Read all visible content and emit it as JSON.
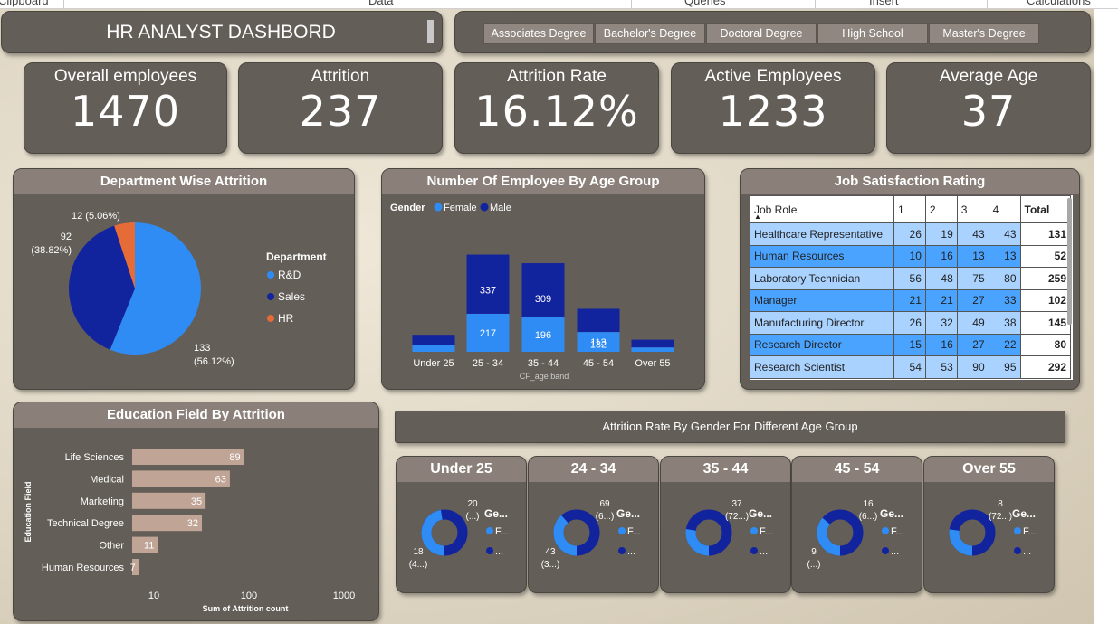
{
  "ribbon": [
    "Clipboard",
    "Data",
    "Queries",
    "Insert",
    "Calculations"
  ],
  "header": {
    "title": "HR  ANALYST DASHBORD"
  },
  "slicer": [
    "Associates Degree",
    "Bachelor's Degree",
    "Doctoral Degree",
    "High School",
    "Master's Degree"
  ],
  "kpis": [
    {
      "label": "Overall employees",
      "value": "1470"
    },
    {
      "label": "Attrition",
      "value": "237"
    },
    {
      "label": "Attrition Rate",
      "value": "16.12%"
    },
    {
      "label": "Active Employees",
      "value": "1233"
    },
    {
      "label": "Average Age",
      "value": "37"
    }
  ],
  "chart_data": [
    {
      "type": "pie",
      "title": "Department Wise Attrition",
      "legend_title": "Department",
      "legend_position": "right",
      "slices": [
        {
          "name": "R&D",
          "value": 133,
          "label": "133",
          "pct_label": "(56.12%)",
          "color": "#2f8cf5"
        },
        {
          "name": "Sales",
          "value": 92,
          "label": "92",
          "pct_label": "(38.82%)",
          "color": "#12239e"
        },
        {
          "name": "HR",
          "value": 12,
          "label": "12 (5.06%)",
          "pct_label": "",
          "color": "#e66c37"
        }
      ]
    },
    {
      "type": "bar",
      "stacked": true,
      "title": "Number Of Employee By Age Group",
      "legend_title": "Gender",
      "legend_position": "top-left",
      "xlabel": "CF_age band",
      "categories": [
        "Under 25",
        "25 - 34",
        "35 - 44",
        "45 - 54",
        "Over 55"
      ],
      "series": [
        {
          "name": "Female",
          "color": "#2f8cf5",
          "values": [
            38,
            217,
            196,
            113,
            25
          ],
          "labels": [
            "",
            "217",
            "196",
            "113",
            ""
          ]
        },
        {
          "name": "Male",
          "color": "#12239e",
          "values": [
            59,
            337,
            309,
            132,
            44
          ],
          "labels": [
            "",
            "337",
            "309",
            "132",
            ""
          ]
        }
      ]
    },
    {
      "type": "table",
      "title": "Job Satisfaction Rating",
      "columns": [
        "Job Role",
        "1",
        "2",
        "3",
        "4",
        "Total"
      ],
      "rows": [
        [
          "Healthcare Representative",
          "26",
          "19",
          "43",
          "43",
          "131"
        ],
        [
          "Human Resources",
          "10",
          "16",
          "13",
          "13",
          "52"
        ],
        [
          "Laboratory Technician",
          "56",
          "48",
          "75",
          "80",
          "259"
        ],
        [
          "Manager",
          "21",
          "21",
          "27",
          "33",
          "102"
        ],
        [
          "Manufacturing Director",
          "26",
          "32",
          "49",
          "38",
          "145"
        ],
        [
          "Research Director",
          "15",
          "16",
          "27",
          "22",
          "80"
        ],
        [
          "Research Scientist",
          "54",
          "53",
          "90",
          "95",
          "292"
        ]
      ]
    },
    {
      "type": "bar",
      "orientation": "horizontal",
      "title": "Education Field By Attrition",
      "ylabel": "Education Field",
      "xlabel": "Sum of Attrition count",
      "x_scale": "log",
      "x_ticks": [
        "10",
        "100",
        "1000"
      ],
      "categories": [
        "Life Sciences",
        "Medical",
        "Marketing",
        "Technical Degree",
        "Other",
        "Human Resources"
      ],
      "values": [
        89,
        63,
        35,
        32,
        11,
        7
      ],
      "color": "#c0a495"
    },
    {
      "type": "pie",
      "donut": true,
      "title": "Attrition Rate By Gender For Different Age Group",
      "panels": [
        {
          "title": "Under 25",
          "female": 18,
          "male": 20,
          "label_male": "20",
          "label_male_sub": "(...)",
          "label_female": "18",
          "label_female_sub": "(4...)",
          "legend_title": "Ge...",
          "legend_items": [
            "F...",
            "..."
          ]
        },
        {
          "title": "24 - 34",
          "female": 43,
          "male": 69,
          "label_male": "69",
          "label_male_sub": "(6...)",
          "label_female": "43",
          "label_female_sub": "(3...)",
          "legend_title": "Ge...",
          "legend_items": [
            "F...",
            "..."
          ]
        },
        {
          "title": "35 - 44",
          "female": 14,
          "male": 37,
          "label_male": "37",
          "label_male_sub": "(72...)",
          "label_female": "",
          "label_female_sub": "",
          "legend_title": "Ge...",
          "legend_items": [
            "F...",
            "..."
          ]
        },
        {
          "title": "45 - 54",
          "female": 9,
          "male": 16,
          "label_male": "16",
          "label_male_sub": "(6...)",
          "label_female": "9",
          "label_female_sub": "(...)",
          "legend_title": "Ge...",
          "legend_items": [
            "F...",
            "..."
          ]
        },
        {
          "title": "Over 55",
          "female": 3,
          "male": 8,
          "label_male": "8",
          "label_male_sub": "(72...)",
          "label_female": "",
          "label_female_sub": "",
          "legend_title": "Ge...",
          "legend_items": [
            "F...",
            "..."
          ]
        }
      ]
    }
  ]
}
